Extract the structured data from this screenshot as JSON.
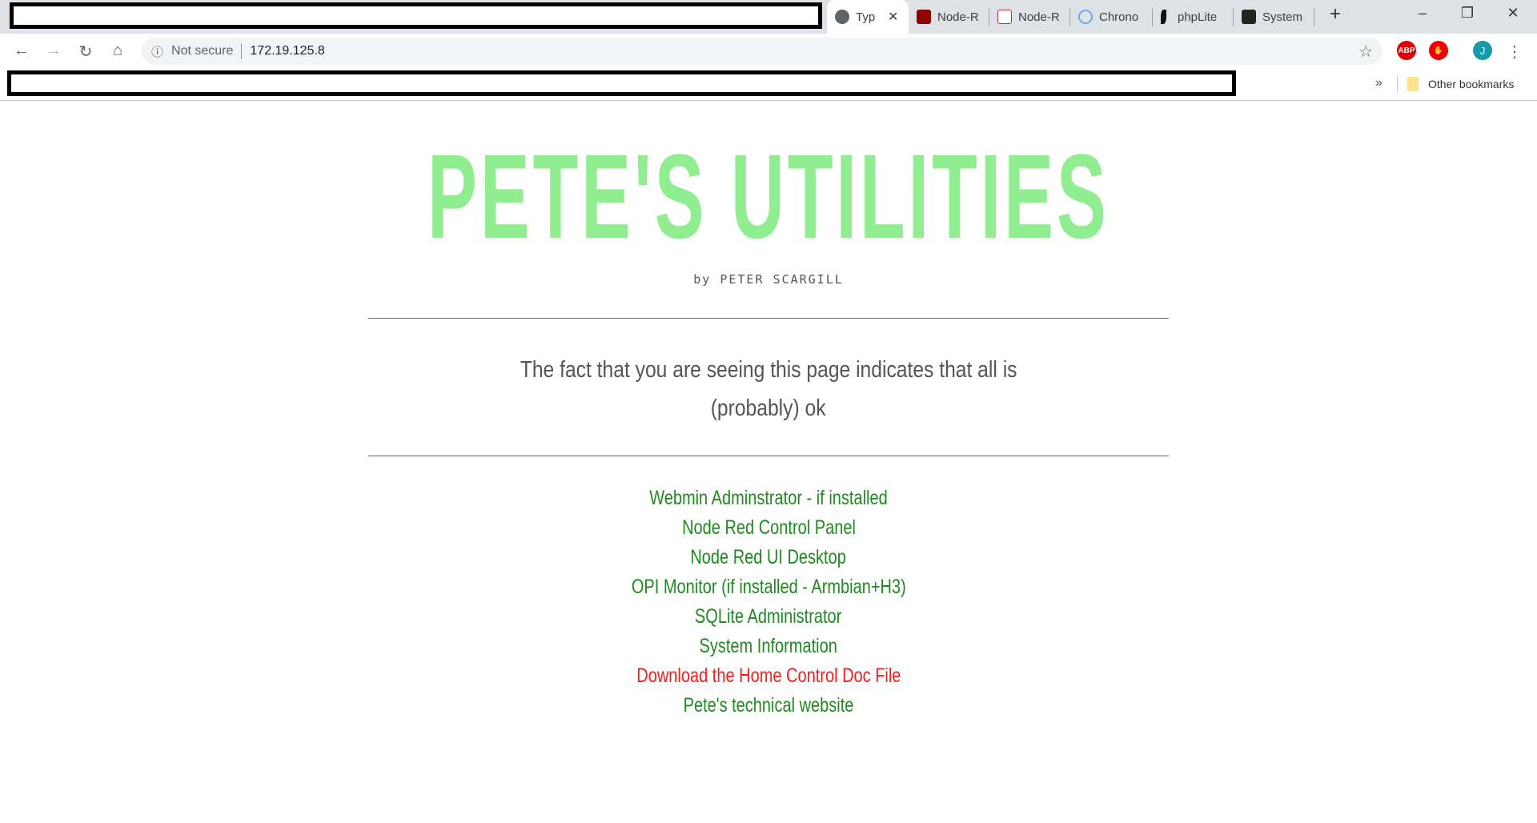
{
  "browser": {
    "tabs": [
      {
        "label": "Typ",
        "icon": "globe-icon",
        "active": true
      },
      {
        "label": "Node-R",
        "icon": "node-red-icon"
      },
      {
        "label": "Node-R",
        "icon": "node-red-icon"
      },
      {
        "label": "Chrono",
        "icon": "chronograf-icon"
      },
      {
        "label": "phpLite",
        "icon": "feather-icon"
      },
      {
        "label": "System",
        "icon": "powershell-icon"
      }
    ],
    "security_label": "Not secure",
    "url": "172.19.125.8",
    "profile_initial": "J",
    "abp_label": "ABP",
    "bookmarks_overflow": "»",
    "other_bookmarks": "Other bookmarks"
  },
  "page": {
    "title": "PETE'S UTILITIES",
    "subtitle": "by PETER SCARGILL",
    "message_line1": "The fact that you are seeing this page indicates that all is",
    "message_line2": "(probably) ok",
    "links": [
      {
        "label": "Webmin Adminstrator - if installed"
      },
      {
        "label": "Node Red Control Panel"
      },
      {
        "label": "Node Red UI Desktop"
      },
      {
        "label": "OPI Monitor (if installed - Armbian+H3)"
      },
      {
        "label": "SQLite Administrator"
      },
      {
        "label": "System Information"
      },
      {
        "label": "Download the Home Control Doc File"
      },
      {
        "label": "Pete's technical website"
      }
    ]
  },
  "colors": {
    "title": "#90ee90",
    "link": "#1f8a1f",
    "link_highlight": "#ff1a1a"
  }
}
